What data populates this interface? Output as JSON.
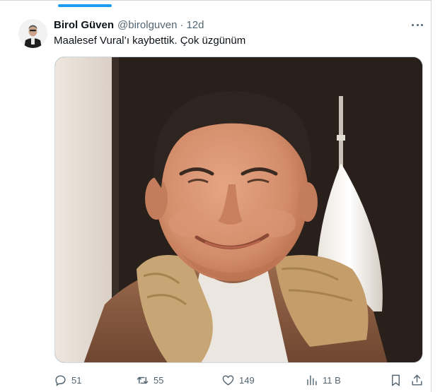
{
  "author": {
    "name": "Birol Güven",
    "handle": "@birolguven",
    "separator": "·",
    "time": "12d",
    "avatar_icon": "person-avatar"
  },
  "tweet": {
    "text": "Maalesef Vural’ı kaybettik. Çok üzgünüm"
  },
  "media": {
    "description_icon": "photo-of-smiling-man"
  },
  "actions": {
    "reply": {
      "icon": "reply-bubble-icon",
      "count": "51"
    },
    "retweet": {
      "icon": "retweet-icon",
      "count": "55"
    },
    "like": {
      "icon": "heart-icon",
      "count": "149"
    },
    "views": {
      "icon": "bar-chart-icon",
      "count": "11 B"
    },
    "bookmark": {
      "icon": "bookmark-icon"
    },
    "share": {
      "icon": "share-icon"
    }
  },
  "colors": {
    "accent": "#1d9bf0",
    "text": "#0f1419",
    "muted": "#536471",
    "border": "#cfd9de"
  }
}
